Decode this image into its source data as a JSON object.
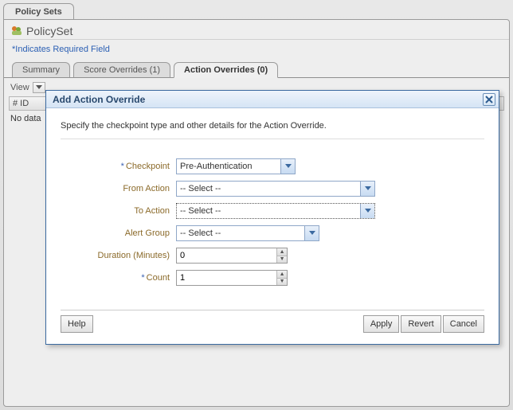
{
  "outer_tab": "Policy Sets",
  "page_title": "PolicySet",
  "required_note": "*Indicates Required Field",
  "tabs": [
    {
      "label": "Summary"
    },
    {
      "label": "Score Overrides (1)"
    },
    {
      "label": "Action Overrides (0)"
    }
  ],
  "grid": {
    "view_label": "View",
    "col0": "# ID",
    "no_data": "No data"
  },
  "dialog": {
    "title": "Add Action Override",
    "intro": "Specify the checkpoint type and other details for the Action Override.",
    "labels": {
      "checkpoint": "Checkpoint",
      "from_action": "From Action",
      "to_action": "To Action",
      "alert_group": "Alert Group",
      "duration": "Duration (Minutes)",
      "count": "Count"
    },
    "values": {
      "checkpoint": "Pre-Authentication",
      "from_action": "-- Select --",
      "to_action": "-- Select --",
      "alert_group": "-- Select --",
      "duration": "0",
      "count": "1"
    },
    "buttons": {
      "help": "Help",
      "apply": "Apply",
      "revert": "Revert",
      "cancel": "Cancel"
    }
  }
}
